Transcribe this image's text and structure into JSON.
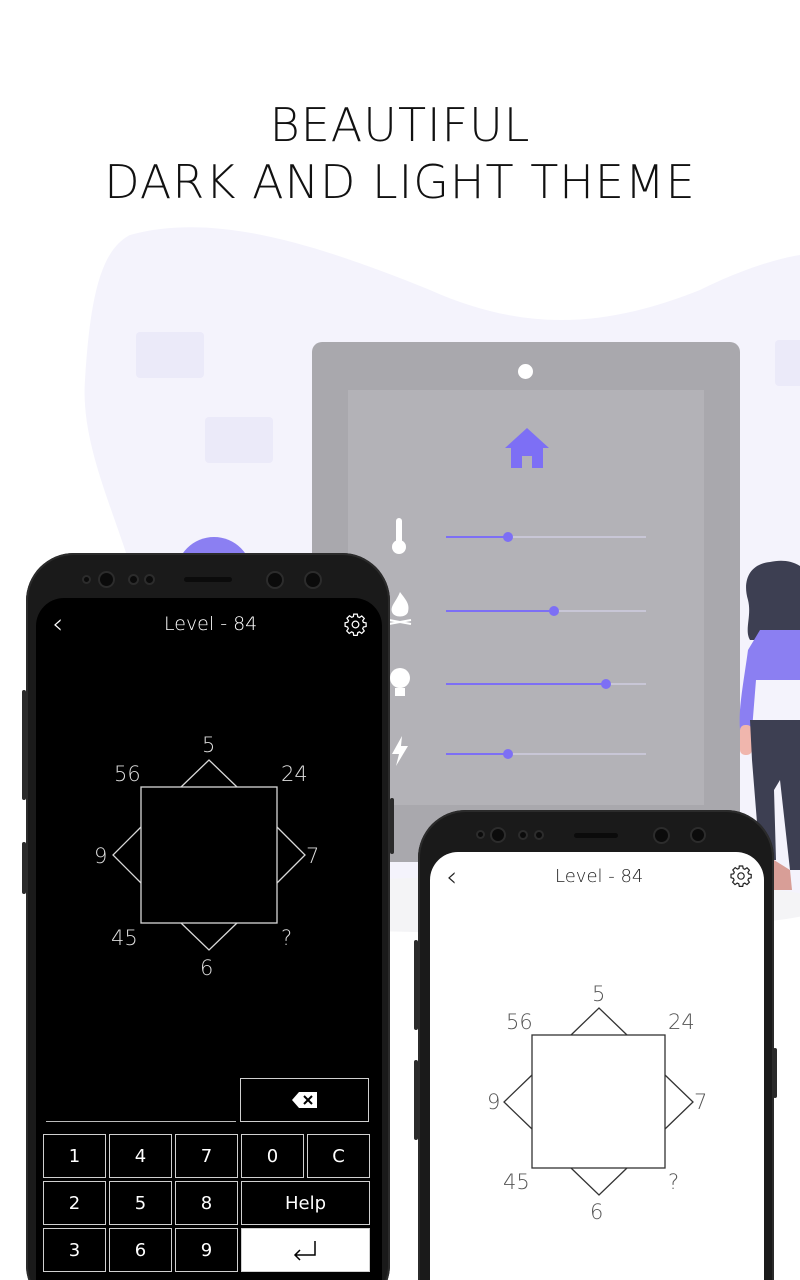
{
  "headline": {
    "line1": "BEAUTIFUL",
    "line2": "DARK AND LIGHT THEME"
  },
  "colors": {
    "accent": "#7d6ff5",
    "tablet": "#a9a8ad",
    "blob": "#f4f3fc"
  },
  "dark_phone": {
    "title": "Level - 84",
    "back_icon": "chevron-left-icon",
    "settings_icon": "gear-icon",
    "puzzle": {
      "top": "5",
      "top_left": "56",
      "top_right": "24",
      "left": "9",
      "right": "7",
      "bottom_left": "45",
      "bottom": "6",
      "bottom_right": "?"
    },
    "keypad": {
      "row1": [
        "1",
        "4",
        "7",
        "0",
        "C"
      ],
      "row2": [
        "2",
        "5",
        "8"
      ],
      "help": "Help",
      "row3": [
        "3",
        "6",
        "9"
      ],
      "enter_icon": "enter-icon",
      "backspace_icon": "backspace-icon"
    }
  },
  "light_phone": {
    "title": "Level - 84",
    "back_icon": "chevron-left-icon",
    "settings_icon": "gear-icon",
    "puzzle": {
      "top": "5",
      "top_left": "56",
      "top_right": "24",
      "left": "9",
      "right": "7",
      "bottom_left": "45",
      "bottom": "6",
      "bottom_right": "?"
    }
  },
  "tablet": {
    "icons": [
      "home-icon",
      "thermometer-icon",
      "fire-icon",
      "bulb-icon",
      "bolt-icon"
    ],
    "sliders": [
      0.31,
      0.54,
      0.8,
      0.31
    ]
  }
}
